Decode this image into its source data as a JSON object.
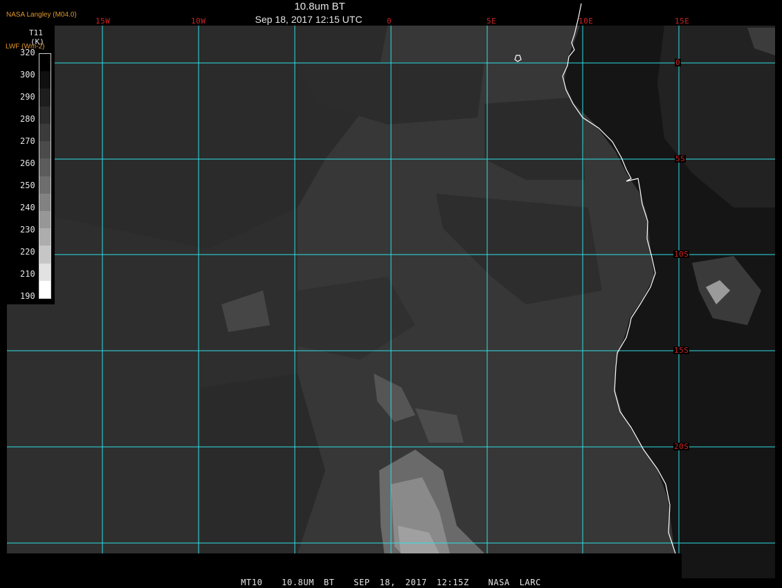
{
  "header": {
    "title": "10.8um BT",
    "timestamp": "Sep 18, 2017 12:15 UTC",
    "credit": "NASA Langley (M04.0)"
  },
  "legend": {
    "name": "T11",
    "unit": "(K)",
    "alt_label": "LWF (Wm-2)",
    "ticks": [
      "320",
      "300",
      "290",
      "280",
      "270",
      "260",
      "250",
      "240",
      "230",
      "220",
      "210",
      "190"
    ]
  },
  "map": {
    "longitude_labels": [
      "15W",
      "10W",
      "0",
      "5E",
      "10E",
      "15E"
    ],
    "latitude_labels": [
      "0",
      "5S",
      "10S",
      "15S",
      "20S"
    ],
    "grid_color": "#2ee0e6",
    "label_color": "#d02424",
    "coastline_color": "#ffffff"
  },
  "footer": {
    "text": "MT10  10.8UM BT  SEP 18, 2017 12:15Z  NASA LARC"
  }
}
